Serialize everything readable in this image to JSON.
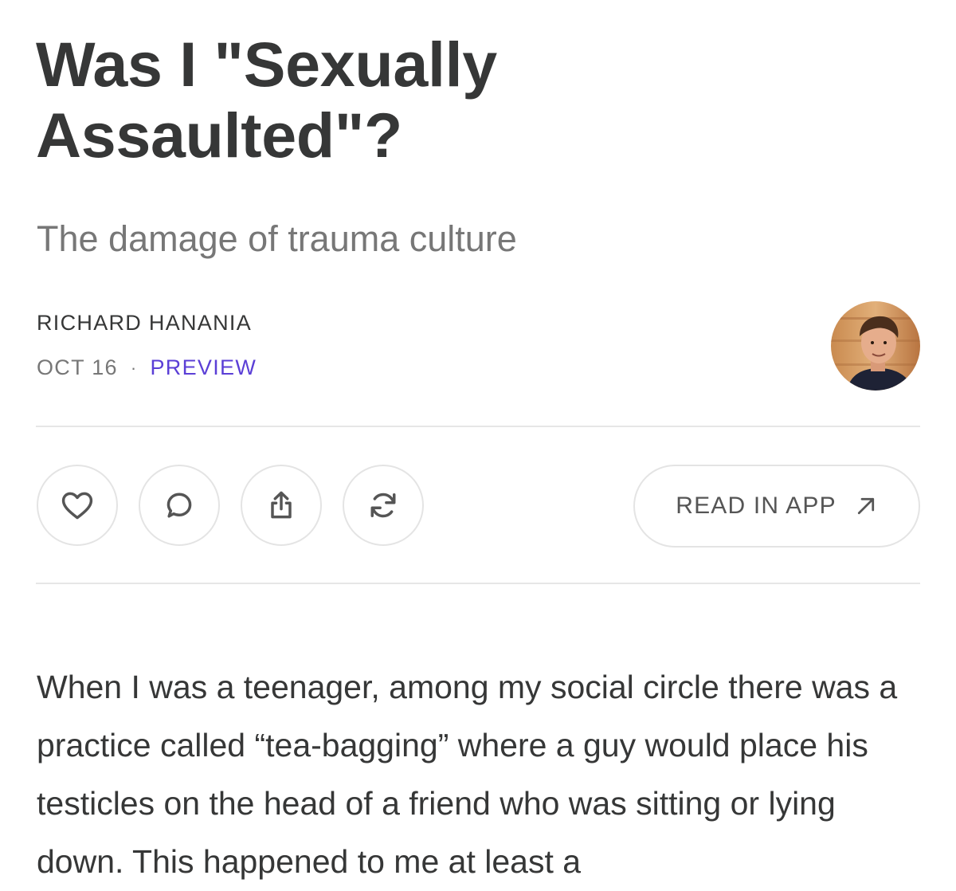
{
  "post": {
    "title_line1": "Was I \"Sexually",
    "title_line2": "Assaulted\"?",
    "subtitle": "The damage of trauma culture",
    "author": "RICHARD HANANIA",
    "date": "OCT 16",
    "separator": "·",
    "tag": "PREVIEW",
    "avatar_icon": "author-avatar-photo"
  },
  "actions": {
    "like_icon": "heart-icon",
    "comment_icon": "comment-icon",
    "share_icon": "share-icon",
    "restack_icon": "restack-icon",
    "read_in_app_label": "READ IN APP",
    "read_in_app_icon": "arrow-up-right-icon"
  },
  "colors": {
    "text": "#363737",
    "muted": "#777777",
    "accent": "#5b3fd6",
    "border": "#e4e4e4"
  },
  "body": {
    "paragraph": "When I was a teenager, among my social circle there was a practice called “tea-bagging” where a guy would place his testicles on the head of a friend who was sitting or lying down. This happened to me at least a"
  }
}
